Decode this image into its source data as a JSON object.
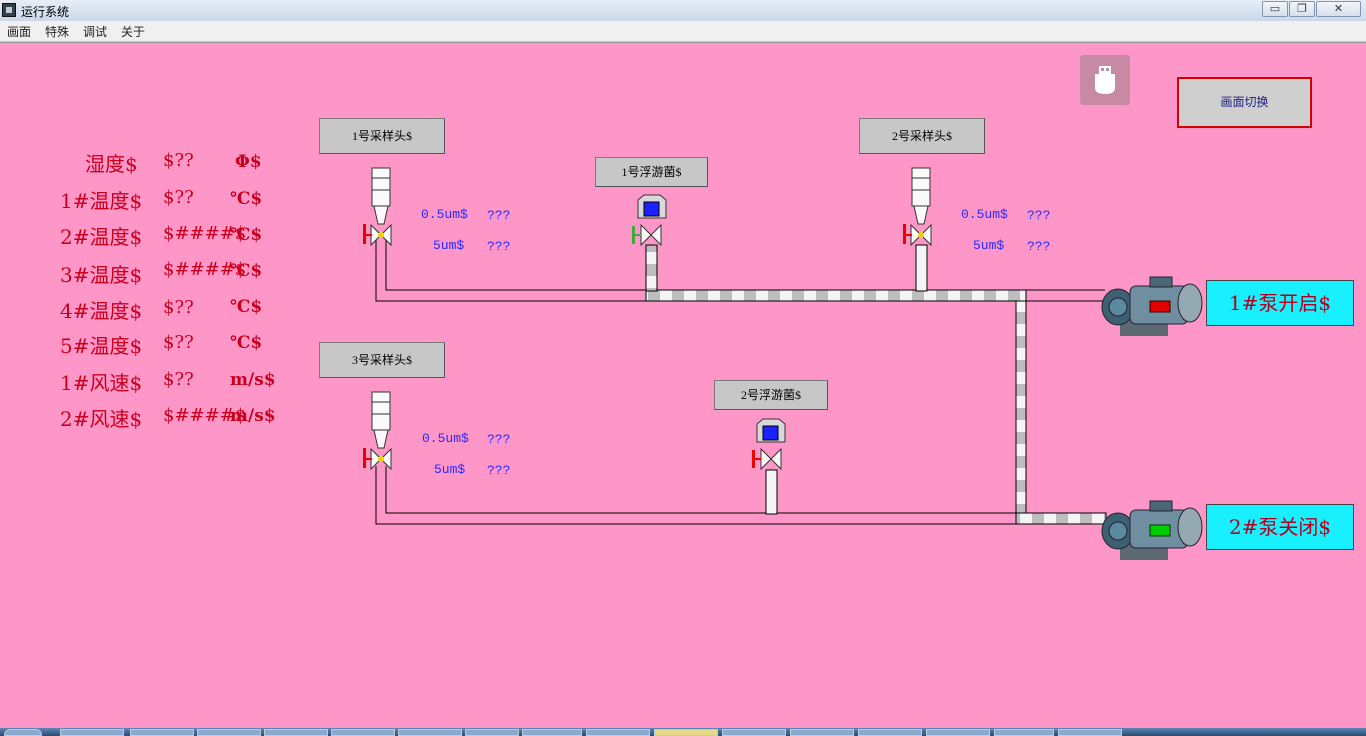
{
  "window": {
    "title": "运行系统",
    "min_glyph": "▭",
    "max_glyph": "❐",
    "close_glyph": "✕"
  },
  "menu": [
    "画面",
    "特殊",
    "调试",
    "关于"
  ],
  "readings": [
    {
      "label": "湿度$",
      "value": "$??",
      "unit": "Φ$"
    },
    {
      "label": "1#温度$",
      "value": "$??",
      "unit": "℃$"
    },
    {
      "label": "2#温度$",
      "value": "$####$",
      "unit": "℃$"
    },
    {
      "label": "3#温度$",
      "value": "$####$",
      "unit": "℃$"
    },
    {
      "label": "4#温度$",
      "value": "$??",
      "unit": "℃$"
    },
    {
      "label": "5#温度$",
      "value": "$??",
      "unit": "℃$"
    },
    {
      "label": "1#风速$",
      "value": "$??",
      "unit": "m/s$"
    },
    {
      "label": "2#风速$",
      "value": "$####$",
      "unit": "m/s$"
    }
  ],
  "samplers": {
    "s1": "1号采样头$",
    "s2": "2号采样头$",
    "s3": "3号采样头$",
    "f1": "1号浮游菌$",
    "f2": "2号浮游菌$"
  },
  "particles": {
    "s1": {
      "a_label": "0.5um$",
      "a_val": "???",
      "b_label": "5um$",
      "b_val": "???"
    },
    "s2": {
      "a_label": "0.5um$",
      "a_val": "???",
      "b_label": "5um$",
      "b_val": "???"
    },
    "s3": {
      "a_label": "0.5um$",
      "a_val": "???",
      "b_label": "5um$",
      "b_val": "???"
    }
  },
  "pumps": {
    "p1": {
      "status": "1#泵开启$",
      "indicator_color": "#e00000"
    },
    "p2": {
      "status": "2#泵关闭$",
      "indicator_color": "#00cc00"
    }
  },
  "switch_button": "画面切换",
  "colors": {
    "background": "#ff96c8",
    "status_bg": "#18f0ff",
    "text_red": "#c8001e",
    "text_blue": "#2a2aff"
  }
}
